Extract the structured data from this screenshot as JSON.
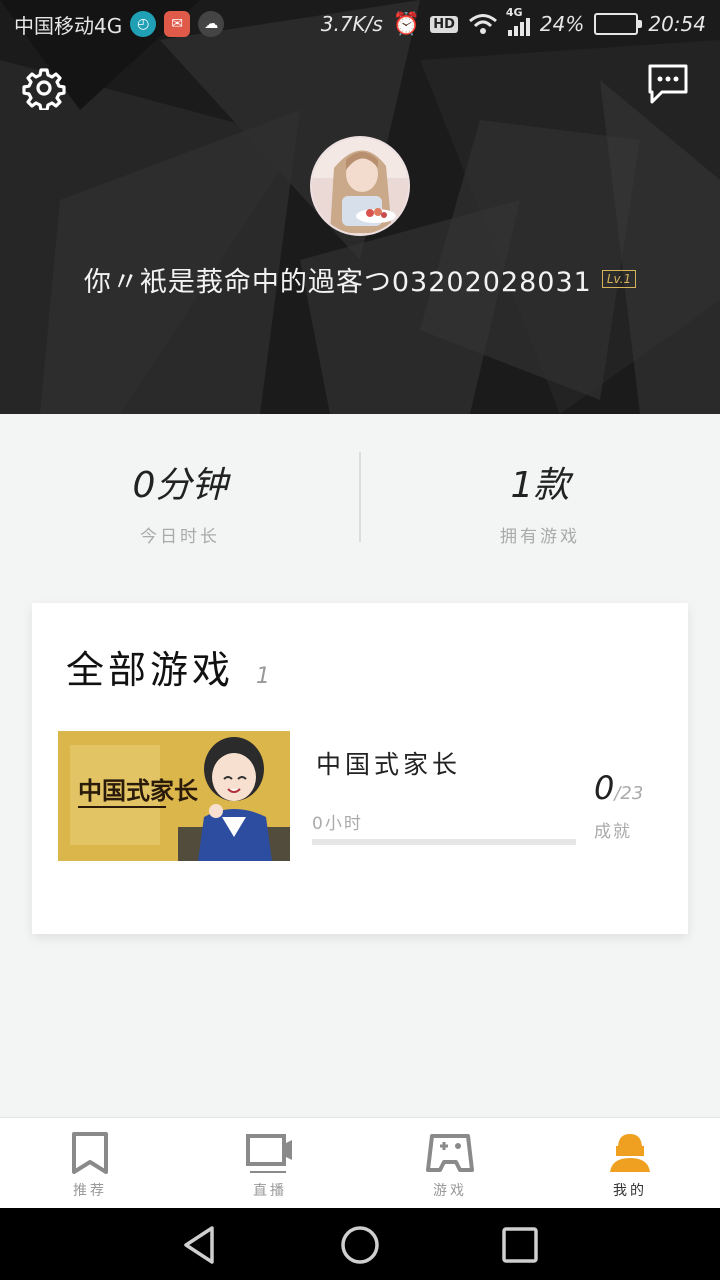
{
  "status_bar": {
    "carrier": "中国移动4G",
    "speed": "3.7K/s",
    "hd": "HD",
    "network": "4G",
    "battery": "24%",
    "battery_level": 0.24,
    "time": "20:54"
  },
  "profile": {
    "username": "你〃衹是莪命中的過客つ03202028031",
    "level": "Lv.1"
  },
  "stats": [
    {
      "value": "0分钟",
      "label": "今日时长"
    },
    {
      "value": "1款",
      "label": "拥有游戏"
    }
  ],
  "games_section": {
    "title": "全部游戏",
    "count": "1",
    "games": [
      {
        "thumb_text": "中国式家长",
        "name": "中国式家长",
        "hours": "0小时",
        "progress": 0,
        "achievements_done": "0",
        "achievements_total": "/23",
        "achievements_label": "成就"
      }
    ]
  },
  "bottom_nav": [
    {
      "label": "推荐",
      "icon": "bookmark-icon",
      "active": false
    },
    {
      "label": "直播",
      "icon": "video-camera-icon",
      "active": false
    },
    {
      "label": "游戏",
      "icon": "gamepad-icon",
      "active": false
    },
    {
      "label": "我的",
      "icon": "user-icon",
      "active": true
    }
  ],
  "colors": {
    "accent": "#f0a020",
    "header_bg": "#1e1e1e",
    "page_bg": "#f3f4f4"
  }
}
